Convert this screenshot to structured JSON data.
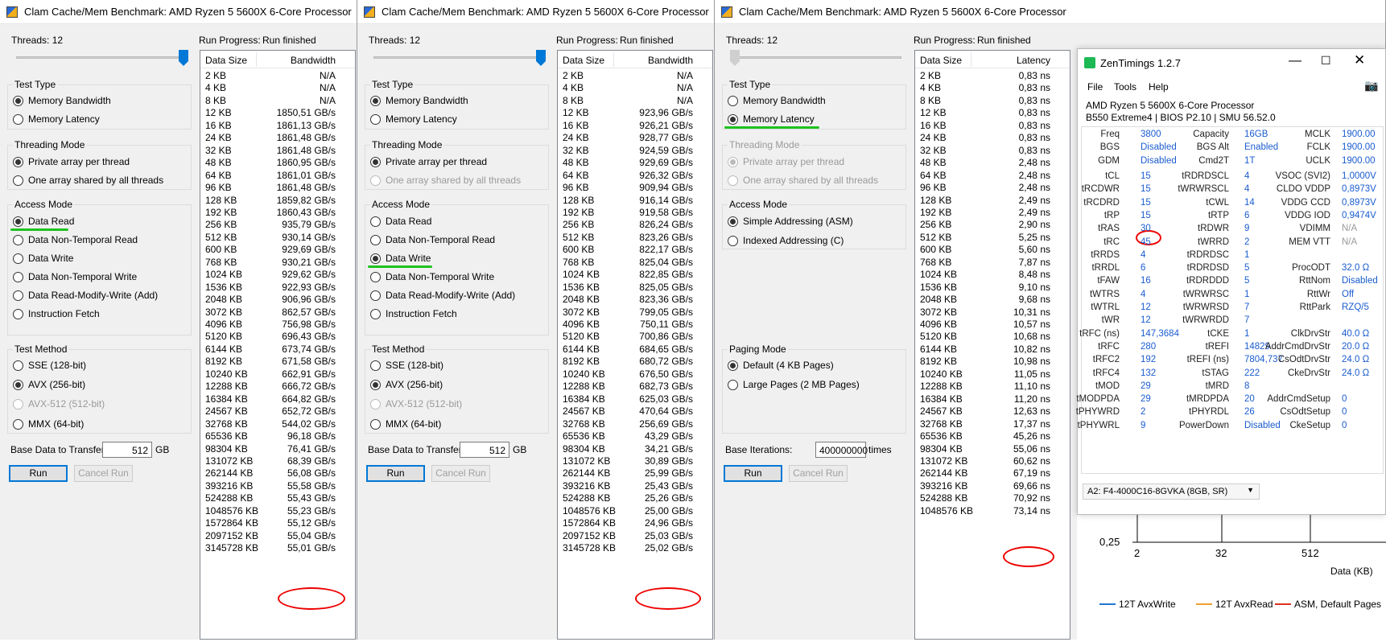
{
  "win_title": "Clam Cache/Mem Benchmark: AMD Ryzen 5 5600X 6-Core Processor",
  "common": {
    "threads": "Threads: 12",
    "run_progress": "Run Progress:",
    "run_status": "Run finished",
    "test_type": "Test Type",
    "mem_bw": "Memory Bandwidth",
    "mem_lat": "Memory Latency",
    "threading_mode": "Threading Mode",
    "private_array": "Private array per thread",
    "one_array": "One array shared by all threads",
    "access_mode": "Access Mode",
    "data_read": "Data Read",
    "data_nt_read": "Data Non-Temporal Read",
    "data_write": "Data Write",
    "data_nt_write": "Data Non-Temporal Write",
    "data_rmw": "Data Read-Modify-Write (Add)",
    "instr_fetch": "Instruction Fetch",
    "test_method": "Test Method",
    "sse": "SSE (128-bit)",
    "avx": "AVX (256-bit)",
    "avx512": "AVX-512 (512-bit)",
    "mmx": "MMX (64-bit)",
    "base_data": "Base Data to Transfer:",
    "base_val": "512",
    "gb": "GB",
    "run": "Run",
    "cancel": "Cancel Run",
    "data_size": "Data Size",
    "bandwidth": "Bandwidth",
    "latency": "Latency",
    "simple_addr": "Simple Addressing (ASM)",
    "indexed_addr": "Indexed Addressing (C)",
    "paging_mode": "Paging Mode",
    "default_pages": "Default (4 KB Pages)",
    "large_pages": "Large Pages (2 MB Pages)",
    "base_iter": "Base Iterations:",
    "iter_val": "400000000",
    "times": "times"
  },
  "sizes1": [
    "2 KB",
    "4 KB",
    "8 KB",
    "12 KB",
    "16 KB",
    "24 KB",
    "32 KB",
    "48 KB",
    "64 KB",
    "96 KB",
    "128 KB",
    "192 KB",
    "256 KB",
    "512 KB",
    "600 KB",
    "768 KB",
    "1024 KB",
    "1536 KB",
    "2048 KB",
    "3072 KB",
    "4096 KB",
    "5120 KB",
    "6144 KB",
    "8192 KB",
    "10240 KB",
    "12288 KB",
    "16384 KB",
    "24567 KB",
    "32768 KB",
    "65536 KB",
    "98304 KB",
    "131072 KB",
    "262144 KB",
    "393216 KB",
    "524288 KB",
    "1048576 KB",
    "1572864 KB",
    "2097152 KB",
    "3145728 KB"
  ],
  "vals1": [
    "N/A",
    "N/A",
    "N/A",
    "1850,51 GB/s",
    "1861,13 GB/s",
    "1861,48 GB/s",
    "1861,48 GB/s",
    "1860,95 GB/s",
    "1861,01 GB/s",
    "1861,48 GB/s",
    "1859,82 GB/s",
    "1860,43 GB/s",
    "935,79 GB/s",
    "930,14 GB/s",
    "929,69 GB/s",
    "930,21 GB/s",
    "929,62 GB/s",
    "922,93 GB/s",
    "906,96 GB/s",
    "862,57 GB/s",
    "756,98 GB/s",
    "696,43 GB/s",
    "673,74 GB/s",
    "671,58 GB/s",
    "662,91 GB/s",
    "666,72 GB/s",
    "664,82 GB/s",
    "652,72 GB/s",
    "544,02 GB/s",
    "96,18 GB/s",
    "76,41 GB/s",
    "68,39 GB/s",
    "56,08 GB/s",
    "55,58 GB/s",
    "55,43 GB/s",
    "55,23 GB/s",
    "55,12 GB/s",
    "55,04 GB/s",
    "55,01 GB/s"
  ],
  "vals2": [
    "N/A",
    "N/A",
    "N/A",
    "923,96 GB/s",
    "926,21 GB/s",
    "928,77 GB/s",
    "924,59 GB/s",
    "929,69 GB/s",
    "926,32 GB/s",
    "909,94 GB/s",
    "916,14 GB/s",
    "919,58 GB/s",
    "826,24 GB/s",
    "823,26 GB/s",
    "822,17 GB/s",
    "825,04 GB/s",
    "822,85 GB/s",
    "825,05 GB/s",
    "823,36 GB/s",
    "799,05 GB/s",
    "750,11 GB/s",
    "700,86 GB/s",
    "684,65 GB/s",
    "680,72 GB/s",
    "676,50 GB/s",
    "682,73 GB/s",
    "625,03 GB/s",
    "470,64 GB/s",
    "256,69 GB/s",
    "43,29 GB/s",
    "34,21 GB/s",
    "30,89 GB/s",
    "25,99 GB/s",
    "25,43 GB/s",
    "25,26 GB/s",
    "25,00 GB/s",
    "24,96 GB/s",
    "25,03 GB/s",
    "25,02 GB/s"
  ],
  "sizes3": [
    "2 KB",
    "4 KB",
    "8 KB",
    "12 KB",
    "16 KB",
    "24 KB",
    "32 KB",
    "48 KB",
    "64 KB",
    "96 KB",
    "128 KB",
    "192 KB",
    "256 KB",
    "512 KB",
    "600 KB",
    "768 KB",
    "1024 KB",
    "1536 KB",
    "2048 KB",
    "3072 KB",
    "4096 KB",
    "5120 KB",
    "6144 KB",
    "8192 KB",
    "10240 KB",
    "12288 KB",
    "16384 KB",
    "24567 KB",
    "32768 KB",
    "65536 KB",
    "98304 KB",
    "131072 KB",
    "262144 KB",
    "393216 KB",
    "524288 KB",
    "1048576 KB"
  ],
  "vals3": [
    "0,83 ns",
    "0,83 ns",
    "0,83 ns",
    "0,83 ns",
    "0,83 ns",
    "0,83 ns",
    "0,83 ns",
    "2,48 ns",
    "2,48 ns",
    "2,48 ns",
    "2,49 ns",
    "2,49 ns",
    "2,90 ns",
    "5,25 ns",
    "5,60 ns",
    "7,87 ns",
    "8,48 ns",
    "9,10 ns",
    "9,68 ns",
    "10,31 ns",
    "10,57 ns",
    "10,68 ns",
    "10,82 ns",
    "10,98 ns",
    "11,05 ns",
    "11,10 ns",
    "11,20 ns",
    "12,63 ns",
    "17,37 ns",
    "45,26 ns",
    "55,06 ns",
    "60,62 ns",
    "67,19 ns",
    "69,66 ns",
    "70,92 ns",
    "73,14 ns"
  ],
  "zen": {
    "title": "ZenTimings 1.2.7",
    "menu": [
      "File",
      "Tools",
      "Help"
    ],
    "cpu": "AMD Ryzen 5 5600X 6-Core Processor",
    "board": "B550 Extreme4 | BIOS P2.10 | SMU 56.52.0",
    "top": [
      [
        "Freq",
        "3800",
        "Capacity",
        "16GB",
        "MCLK",
        "1900.00"
      ],
      [
        "BGS",
        "Disabled",
        "BGS Alt",
        "Enabled",
        "FCLK",
        "1900.00"
      ],
      [
        "GDM",
        "Disabled",
        "Cmd2T",
        "1T",
        "UCLK",
        "1900.00"
      ]
    ],
    "rows": [
      [
        "tCL",
        "15",
        "tRDRDSCL",
        "4",
        "VSOC (SVI2)",
        "1,0000V"
      ],
      [
        "tRCDWR",
        "15",
        "tWRWRSCL",
        "4",
        "CLDO VDDP",
        "0,8973V"
      ],
      [
        "tRCDRD",
        "15",
        "tCWL",
        "14",
        "VDDG CCD",
        "0,8973V"
      ],
      [
        "tRP",
        "15",
        "tRTP",
        "6",
        "VDDG IOD",
        "0,9474V"
      ],
      [
        "tRAS",
        "30",
        "tRDWR",
        "9",
        "VDIMM",
        "N/A"
      ],
      [
        "tRC",
        "45",
        "tWRRD",
        "2",
        "MEM VTT",
        "N/A"
      ],
      [
        "tRRDS",
        "4",
        "tRDRDSC",
        "1",
        "",
        ""
      ],
      [
        "tRRDL",
        "6",
        "tRDRDSD",
        "5",
        "ProcODT",
        "32.0 Ω"
      ],
      [
        "tFAW",
        "16",
        "tRDRDDD",
        "5",
        "RttNom",
        "Disabled"
      ],
      [
        "tWTRS",
        "4",
        "tWRWRSC",
        "1",
        "RttWr",
        "Off"
      ],
      [
        "tWTRL",
        "12",
        "tWRWRSD",
        "7",
        "RttPark",
        "RZQ/5"
      ],
      [
        "tWR",
        "12",
        "tWRWRDD",
        "7",
        "",
        ""
      ],
      [
        "tRFC (ns)",
        "147,3684",
        "tCKE",
        "1",
        "ClkDrvStr",
        "40.0 Ω"
      ],
      [
        "tRFC",
        "280",
        "tREFI",
        "14829",
        "AddrCmdDrvStr",
        "20.0 Ω"
      ],
      [
        "tRFC2",
        "192",
        "tREFI (ns)",
        "7804,737",
        "CsOdtDrvStr",
        "24.0 Ω"
      ],
      [
        "tRFC4",
        "132",
        "tSTAG",
        "222",
        "CkeDrvStr",
        "24.0 Ω"
      ],
      [
        "tMOD",
        "29",
        "tMRD",
        "8",
        "",
        ""
      ],
      [
        "tMODPDA",
        "29",
        "tMRDPDA",
        "20",
        "AddrCmdSetup",
        "0"
      ],
      [
        "tPHYWRD",
        "2",
        "tPHYRDL",
        "26",
        "CsOdtSetup",
        "0"
      ],
      [
        "tPHYWRL",
        "9",
        "PowerDown",
        "Disabled",
        "CkeSetup",
        "0"
      ]
    ],
    "dimm": "A2: F4-4000C16-8GVKA (8GB, SR)"
  },
  "chart": {
    "ytick": "0,25",
    "xticks": [
      "2",
      "32",
      "512"
    ],
    "xlabel": "Data (KB)",
    "legend": [
      "12T AvxWrite",
      "12T AvxRead",
      "ASM, Default Pages"
    ],
    "colors": [
      "#1f77d4",
      "#f0a030",
      "#e03020"
    ]
  }
}
